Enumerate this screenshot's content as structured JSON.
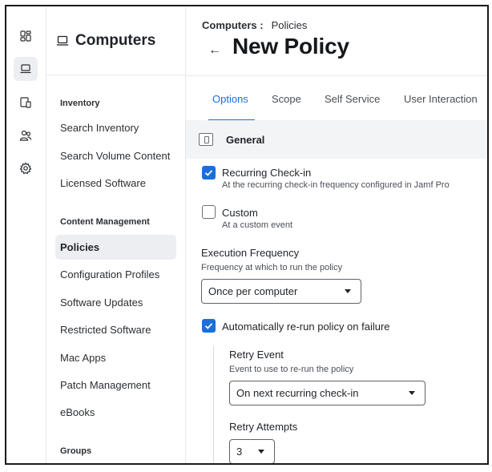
{
  "app": {
    "section_title": "Computers"
  },
  "rail": {
    "items": [
      {
        "icon": "dashboard-icon",
        "active": false
      },
      {
        "icon": "laptop-icon",
        "active": true
      },
      {
        "icon": "devices-icon",
        "active": false
      },
      {
        "icon": "users-icon",
        "active": false
      },
      {
        "icon": "gear-icon",
        "active": false
      }
    ]
  },
  "sidebar": {
    "inventory_heading": "Inventory",
    "inventory_items": [
      "Search Inventory",
      "Search Volume Content",
      "Licensed Software"
    ],
    "content_heading": "Content Management",
    "content_items": [
      "Policies",
      "Configuration Profiles",
      "Software Updates",
      "Restricted Software",
      "Mac Apps",
      "Patch Management",
      "eBooks"
    ],
    "groups_heading": "Groups"
  },
  "header": {
    "breadcrumb_parent": "Computers :",
    "breadcrumb_current": "Policies",
    "back_glyph": "←",
    "title": "New Policy"
  },
  "tabs": [
    "Options",
    "Scope",
    "Self Service",
    "User Interaction"
  ],
  "general": {
    "title": "General",
    "recurring_label": "Recurring Check-in",
    "recurring_desc": "At the recurring check-in frequency configured in Jamf Pro",
    "recurring_checked": true,
    "custom_label": "Custom",
    "custom_desc": "At a custom event",
    "custom_checked": false,
    "exec_freq_label": "Execution Frequency",
    "exec_freq_desc": "Frequency at which to run the policy",
    "exec_freq_value": "Once per computer",
    "rerun_label": "Automatically re-run policy on failure",
    "rerun_checked": true,
    "retry_event_label": "Retry Event",
    "retry_event_desc": "Event to use to re-run the policy",
    "retry_event_value": "On next recurring check-in",
    "retry_attempts_label": "Retry Attempts",
    "retry_attempts_value": "3"
  },
  "colors": {
    "accent": "#1a6fd8",
    "active_bg": "#eceef1",
    "section_bg": "#f3f4f6"
  }
}
